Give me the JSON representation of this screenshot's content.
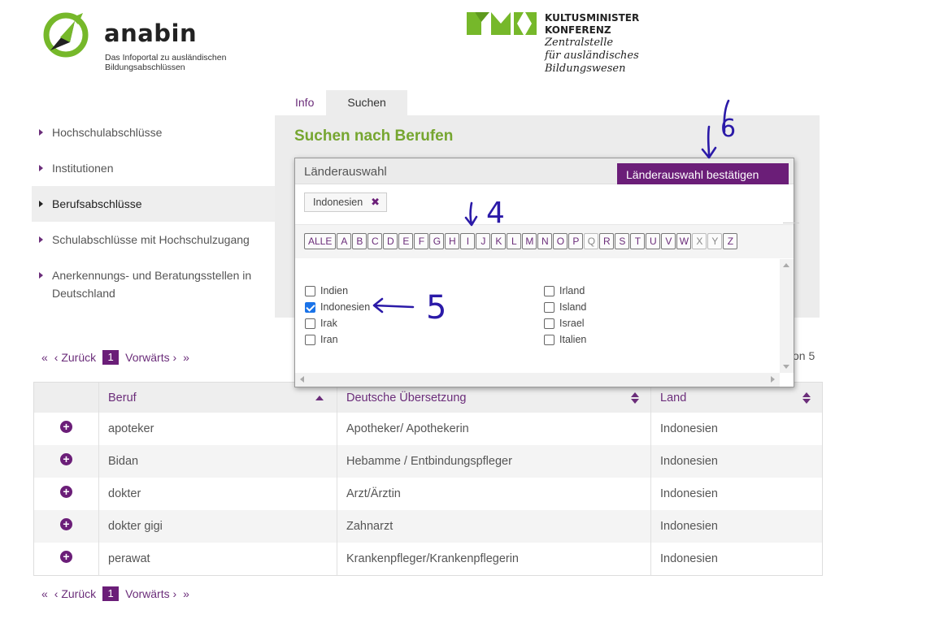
{
  "header": {
    "anabin_name": "anabin",
    "anabin_tagline_1": "Das Infoportal zu ausländischen",
    "anabin_tagline_2": "Bildungsabschlüssen",
    "kmk_org_1": "KULTUSMINISTER",
    "kmk_org_2": "KONFERENZ",
    "kmk_sub_1": "Zentralstelle",
    "kmk_sub_2": "für ausländisches",
    "kmk_sub_3": "Bildungswesen",
    "brand_green": "#76b82a",
    "brand_purple": "#6b1e78"
  },
  "tabs": [
    {
      "label": "Info"
    },
    {
      "label": "Suchen"
    }
  ],
  "sidebar": {
    "items": [
      {
        "label": "Hochschulabschlüsse"
      },
      {
        "label": "Institutionen"
      },
      {
        "label": "Berufsabschlüsse"
      },
      {
        "label": "Schulabschlüsse mit Hochschulzugang"
      },
      {
        "label": "Anerkennungs- und Beratungsstellen in Deutschland"
      }
    ]
  },
  "search": {
    "title": "Suchen nach Berufen"
  },
  "modal": {
    "title": "Länderauswahl",
    "confirm_label": "Länderauswahl bestätigen",
    "selected_tag": "Indonesien",
    "tag_remove_icon": "✖",
    "letters": [
      "ALLE",
      "A",
      "B",
      "C",
      "D",
      "E",
      "F",
      "G",
      "H",
      "I",
      "J",
      "K",
      "L",
      "M",
      "N",
      "O",
      "P",
      "Q",
      "R",
      "S",
      "T",
      "U",
      "V",
      "W",
      "X",
      "Y",
      "Z"
    ],
    "countries_col1": [
      {
        "name": "Indien",
        "checked": false
      },
      {
        "name": "Indonesien",
        "checked": true
      },
      {
        "name": "Irak",
        "checked": false
      },
      {
        "name": "Iran",
        "checked": false
      }
    ],
    "countries_col2": [
      {
        "name": "Irland",
        "checked": false
      },
      {
        "name": "Island",
        "checked": false
      },
      {
        "name": "Israel",
        "checked": false
      },
      {
        "name": "Italien",
        "checked": false
      }
    ]
  },
  "pagination": {
    "first": "«",
    "prev": "‹ Zurück",
    "current": "1",
    "next": "Vorwärts ›",
    "last": "»",
    "of_text": "on 5"
  },
  "table": {
    "headers": [
      "Beruf",
      "Deutsche Übersetzung",
      "Land"
    ],
    "rows": [
      {
        "beruf": "apoteker",
        "uebersetzung": "Apotheker/ Apothekerin",
        "land": "Indonesien"
      },
      {
        "beruf": "Bidan",
        "uebersetzung": "Hebamme / Entbindungspfleger",
        "land": "Indonesien"
      },
      {
        "beruf": "dokter",
        "uebersetzung": "Arzt/Ärztin",
        "land": "Indonesien"
      },
      {
        "beruf": "dokter gigi",
        "uebersetzung": "Zahnarzt",
        "land": "Indonesien"
      },
      {
        "beruf": "perawat",
        "uebersetzung": "Krankenpfleger/Krankenpflegerin",
        "land": "Indonesien"
      }
    ]
  },
  "annotations": {
    "step_4": "4",
    "step_5": "5",
    "step_6": "6"
  }
}
